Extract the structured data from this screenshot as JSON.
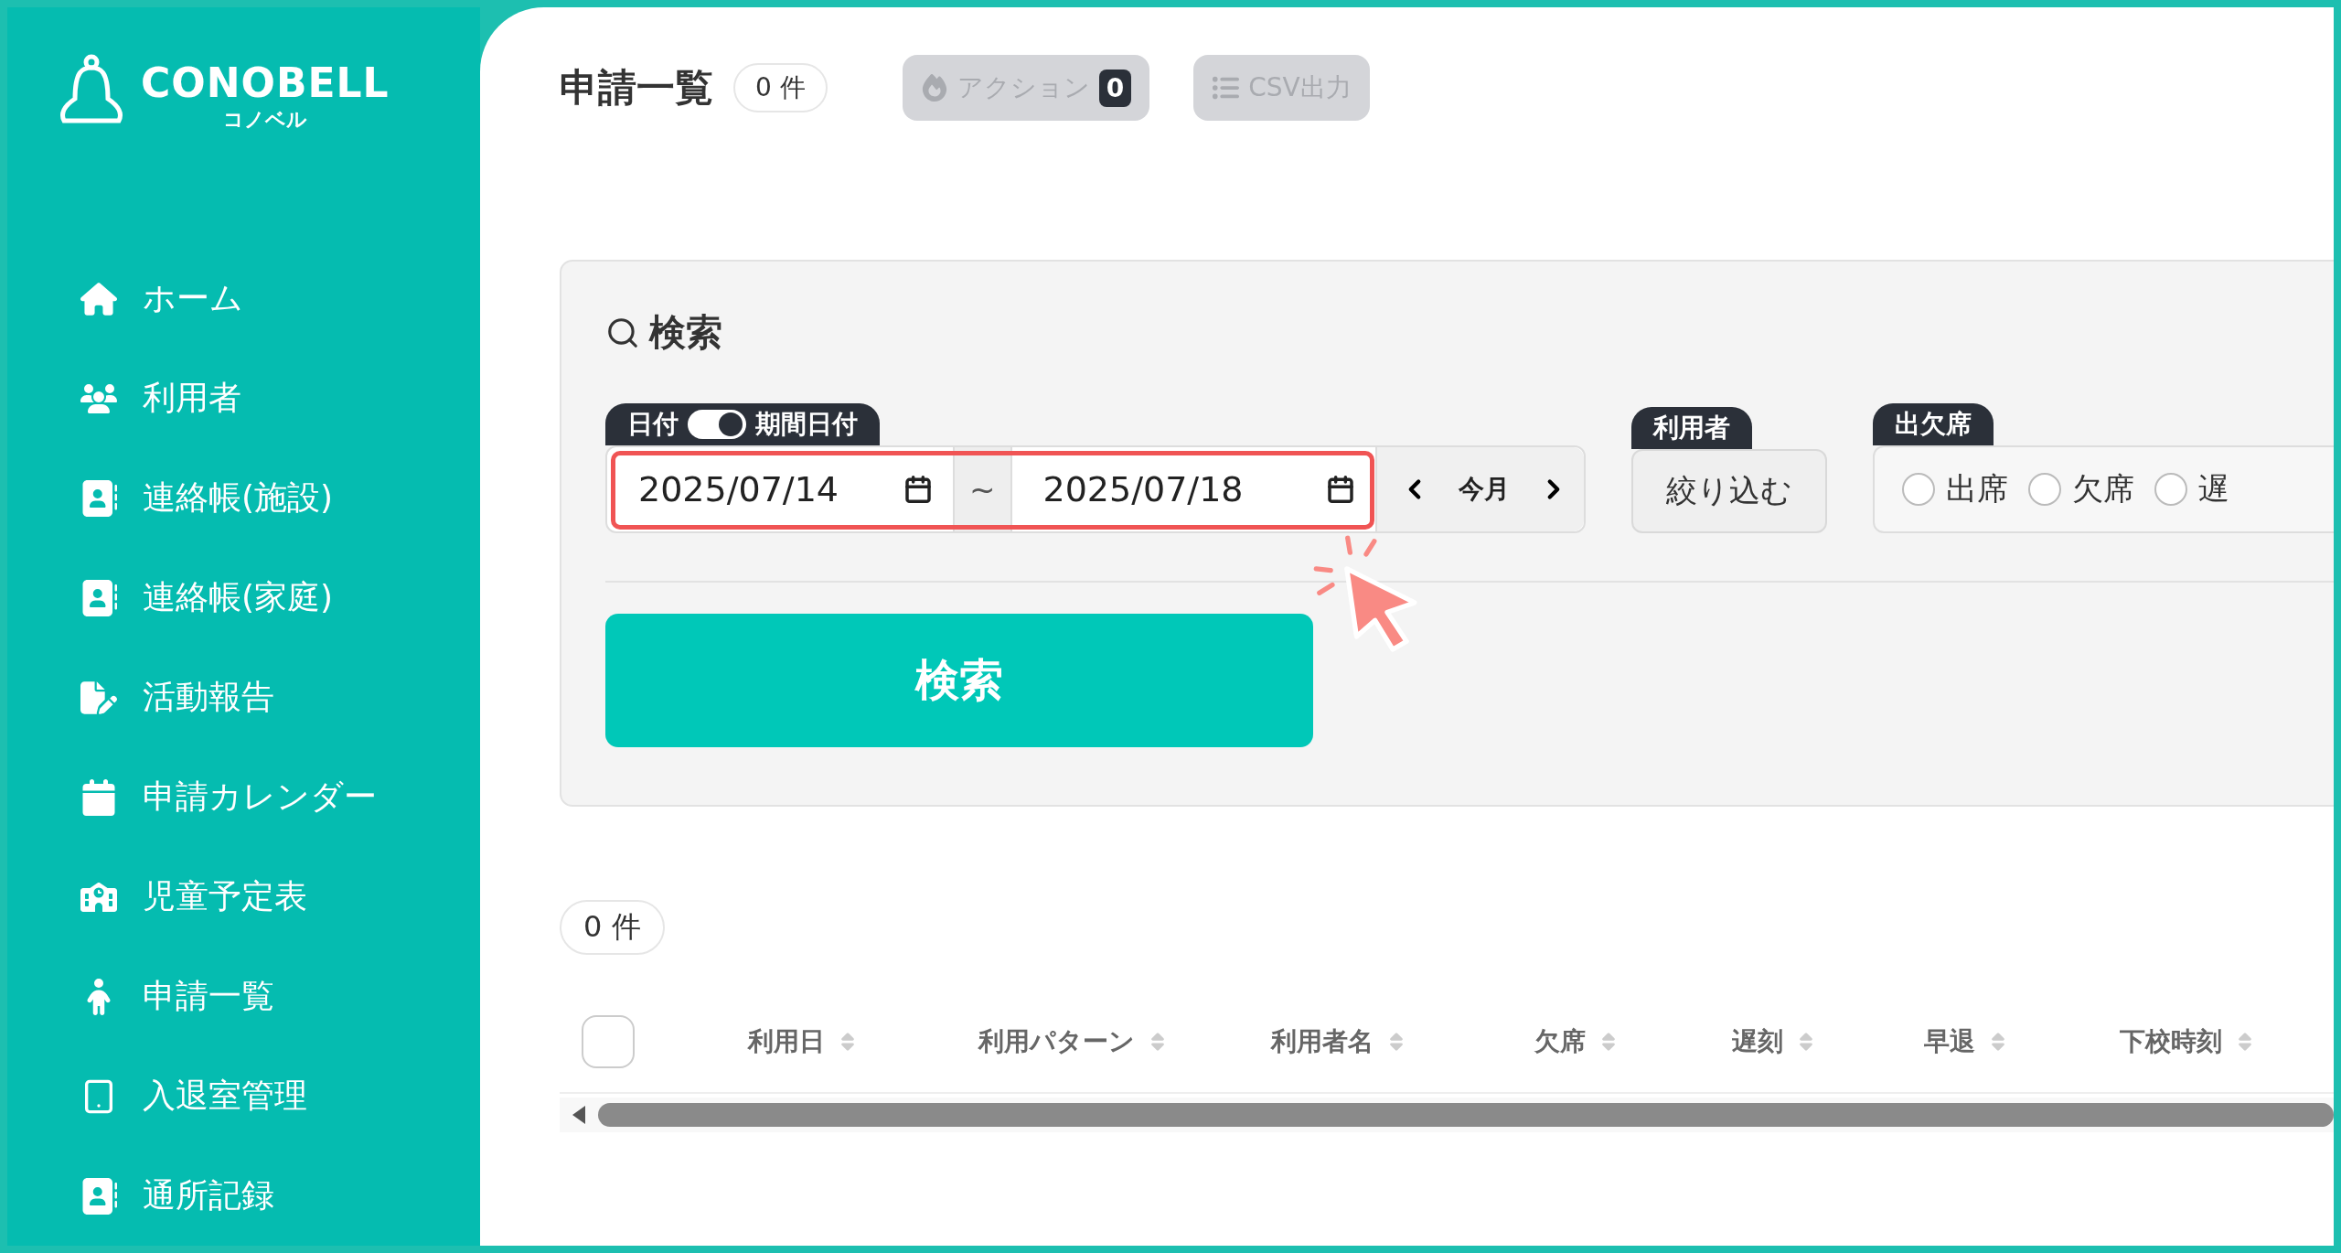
{
  "sidebar": {
    "logo": {
      "wordmark": "CONOBELL",
      "kana": "コノベル"
    },
    "items": [
      {
        "label": "ホーム"
      },
      {
        "label": "利用者"
      },
      {
        "label": "連絡帳(施設)"
      },
      {
        "label": "連絡帳(家庭)"
      },
      {
        "label": "活動報告"
      },
      {
        "label": "申請カレンダー"
      },
      {
        "label": "児童予定表"
      },
      {
        "label": "申請一覧"
      },
      {
        "label": "入退室管理"
      },
      {
        "label": "通所記録"
      }
    ]
  },
  "header": {
    "title": "申請一覧",
    "count": "0 件",
    "buttons": [
      {
        "label": "アクション",
        "badge": "0",
        "disabled": true
      },
      {
        "label": "CSV出力",
        "disabled": true
      }
    ]
  },
  "search": {
    "title": "検索",
    "date": {
      "label_left": "日付",
      "label_right": "期間日付",
      "period_mode": true,
      "from": "2025/07/14",
      "separator": "~",
      "to": "2025/07/18",
      "month_button": "今月"
    },
    "user_filter": {
      "label": "利用者",
      "button": "絞り込む"
    },
    "attendance": {
      "label": "出欠席",
      "options": [
        {
          "label": "出席",
          "selected": false
        },
        {
          "label": "欠席",
          "selected": false
        },
        {
          "label": "遅",
          "selected": false
        }
      ]
    },
    "submit": "検索"
  },
  "results": {
    "count": "0 件",
    "select_all_checked": false,
    "columns": [
      "利用日",
      "利用パターン",
      "利用者名",
      "欠席",
      "遅刻",
      "早退",
      "下校時刻"
    ]
  }
}
